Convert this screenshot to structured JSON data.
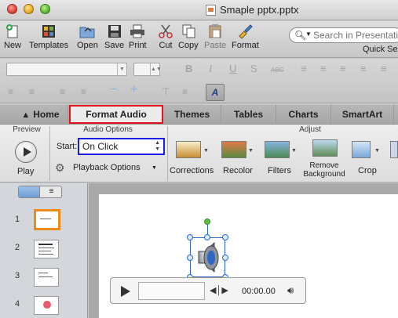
{
  "window": {
    "title": "Smaple pptx.pptx"
  },
  "toolbar": {
    "buttons": [
      "New",
      "Templates",
      "Open",
      "Save",
      "Print",
      "Cut",
      "Copy",
      "Paste",
      "Format"
    ],
    "search_placeholder": "Search in Presentation",
    "quick_label": "Quick Se"
  },
  "format_bar": {
    "bold": "B",
    "italic": "I",
    "underline": "U",
    "strike": "S",
    "abc": "ABC"
  },
  "tabs": [
    "Home",
    "Format Audio",
    "Themes",
    "Tables",
    "Charts",
    "SmartArt"
  ],
  "ribbon": {
    "preview_header": "Preview",
    "play_label": "Play",
    "audio_options_header": "Audio Options",
    "start_label": "Start:",
    "start_value": "On Click",
    "playback_options": "Playback Options",
    "adjust_header": "Adjust",
    "adjust_buttons": [
      "Corrections",
      "Recolor",
      "Filters",
      "Remove Background",
      "Crop"
    ]
  },
  "slides": [
    {
      "number": "1",
      "selected": true
    },
    {
      "number": "2",
      "selected": false
    },
    {
      "number": "3",
      "selected": false
    },
    {
      "number": "4",
      "selected": false
    }
  ],
  "player": {
    "time": "00:00.00"
  },
  "colors": {
    "highlight_red": "#e1131c",
    "highlight_blue": "#1d1ee5",
    "selected_thumb": "#f08a18"
  }
}
